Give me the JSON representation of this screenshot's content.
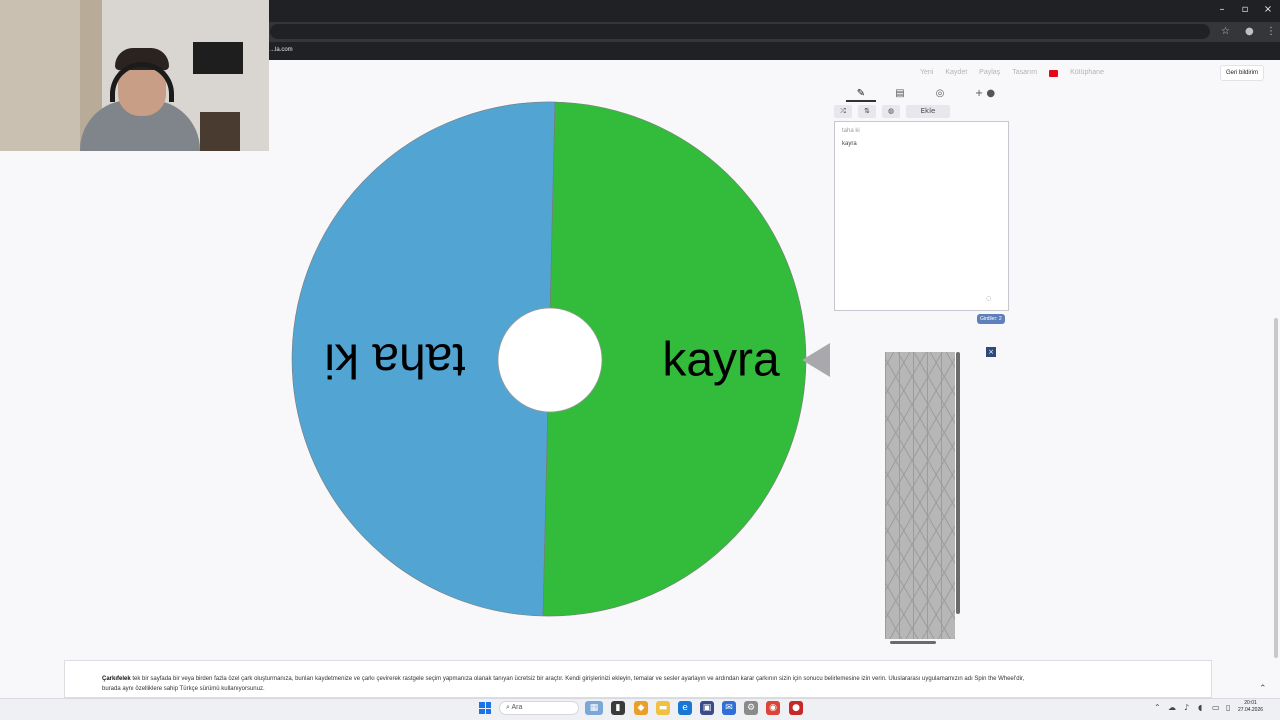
{
  "browser": {
    "window_controls": [
      "–",
      "▫",
      "×"
    ],
    "url": "...la.com",
    "icons": {
      "bookmark": "star-icon",
      "profile": "profile-icon",
      "menu": "kebab-menu-icon"
    }
  },
  "site_nav": {
    "items": [
      "Yeni",
      "Kaydet",
      "Paylaş",
      "Tasarım",
      "Kütüphane"
    ],
    "feedback": "Geri bildirim"
  },
  "wheel": {
    "segments": [
      {
        "label": "taha ki",
        "color": "#52a5d3"
      },
      {
        "label": "kayra",
        "color": "#33bb3b"
      }
    ],
    "center_color": "#ffffff",
    "pointer_color": "#a9a9ad"
  },
  "panel": {
    "tab_icons": [
      "pencil-icon",
      "clipboard-icon",
      "eye-off-icon",
      "plus-icon"
    ],
    "toolbar": {
      "shuffle": "⤮",
      "sort": "⇅",
      "image": "◍",
      "add_image_label": "Ekle"
    },
    "entries": [
      "taha ki",
      "kayra"
    ],
    "count_label": "Girdiler: 2"
  },
  "footer": {
    "brand": "Çarkıfelek",
    "text_line1": " tek bir sayfada bir veya birden fazla özel çark oluşturmanıza, bunları kaydetmenize ve çarkı çevirerek rastgele seçim yapmanıza olanak tanıyan ücretsiz bir araçtır. Kendi girişlerinizi ekleyin, temalar ve sesler ayarlayın ve ardından karar çarkının sizin için sonucu belirlemesine izin verin. Uluslararası uygulamamızın adı Spin the Wheel'dir,",
    "text_line2": "burada aynı özelliklere sahip Türkçe sürümü kullanıyorsunuz."
  },
  "taskbar": {
    "search_placeholder": "Ara",
    "clock_time": "20:01",
    "clock_date": "27.04.2026"
  }
}
